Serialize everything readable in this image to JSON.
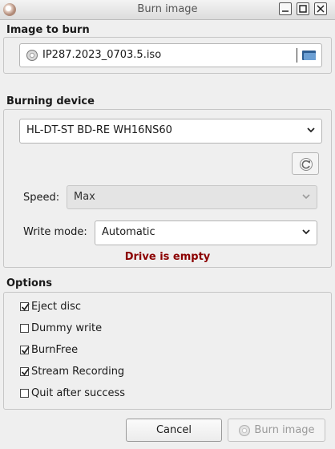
{
  "window": {
    "title": "Burn image"
  },
  "image_section": {
    "title": "Image to burn",
    "file_name": "IP287.2023_0703.5.iso"
  },
  "device_section": {
    "title": "Burning device",
    "device": "HL-DT-ST BD-RE  WH16NS60",
    "speed_label": "Speed:",
    "speed_value": "Max",
    "write_mode_label": "Write mode:",
    "write_mode_value": "Automatic",
    "status": "Drive is empty",
    "status_color": "#8b0000"
  },
  "options_section": {
    "title": "Options",
    "items": [
      {
        "label": "Eject disc",
        "checked": true
      },
      {
        "label": "Dummy write",
        "checked": false
      },
      {
        "label": "BurnFree",
        "checked": true
      },
      {
        "label": "Stream Recording",
        "checked": true
      },
      {
        "label": "Quit after success",
        "checked": false
      }
    ]
  },
  "buttons": {
    "cancel": "Cancel",
    "burn": "Burn image"
  }
}
